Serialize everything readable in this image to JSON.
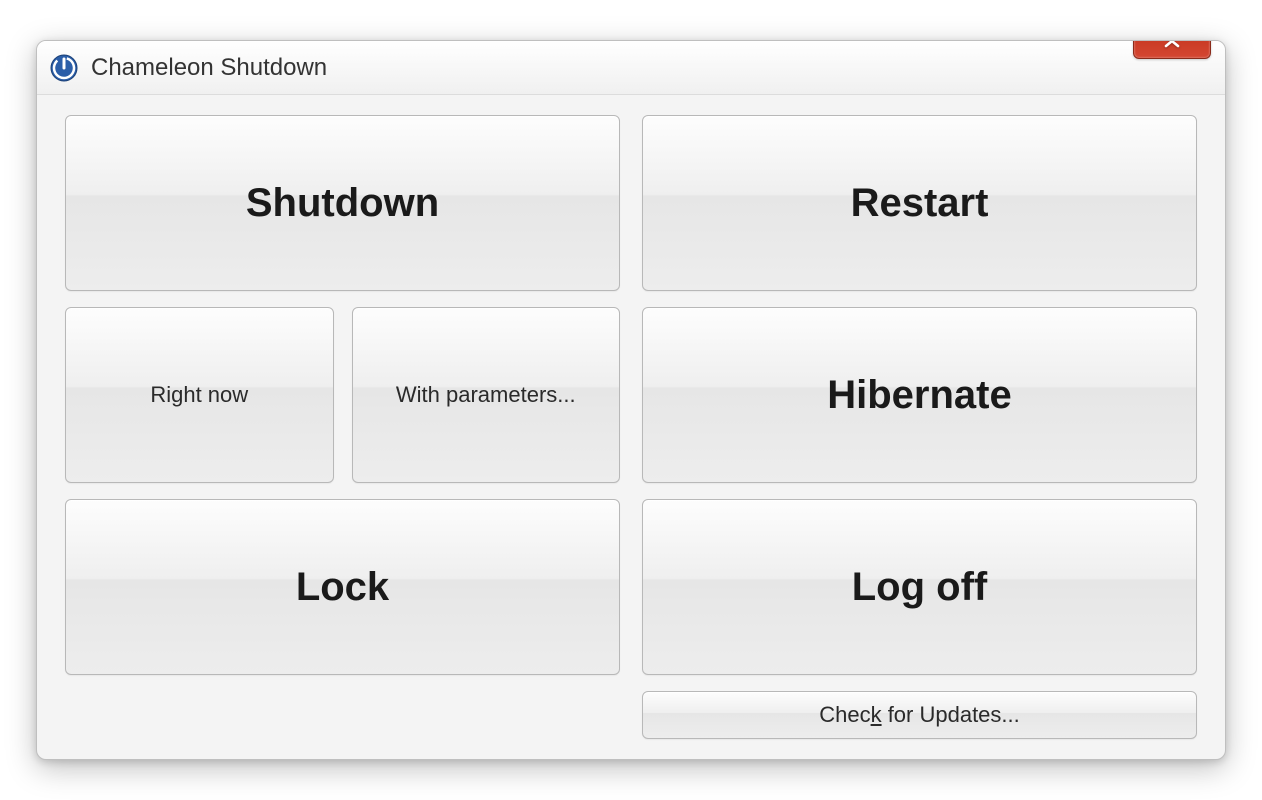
{
  "window": {
    "title": "Chameleon Shutdown"
  },
  "buttons": {
    "shutdown": "Shutdown",
    "restart": "Restart",
    "right_now": "Right now",
    "with_parameters": "With parameters...",
    "hibernate": "Hibernate",
    "lock": "Lock",
    "log_off": "Log off",
    "check_updates_pre": "Chec",
    "check_updates_k": "k",
    "check_updates_post": " for Updates..."
  }
}
